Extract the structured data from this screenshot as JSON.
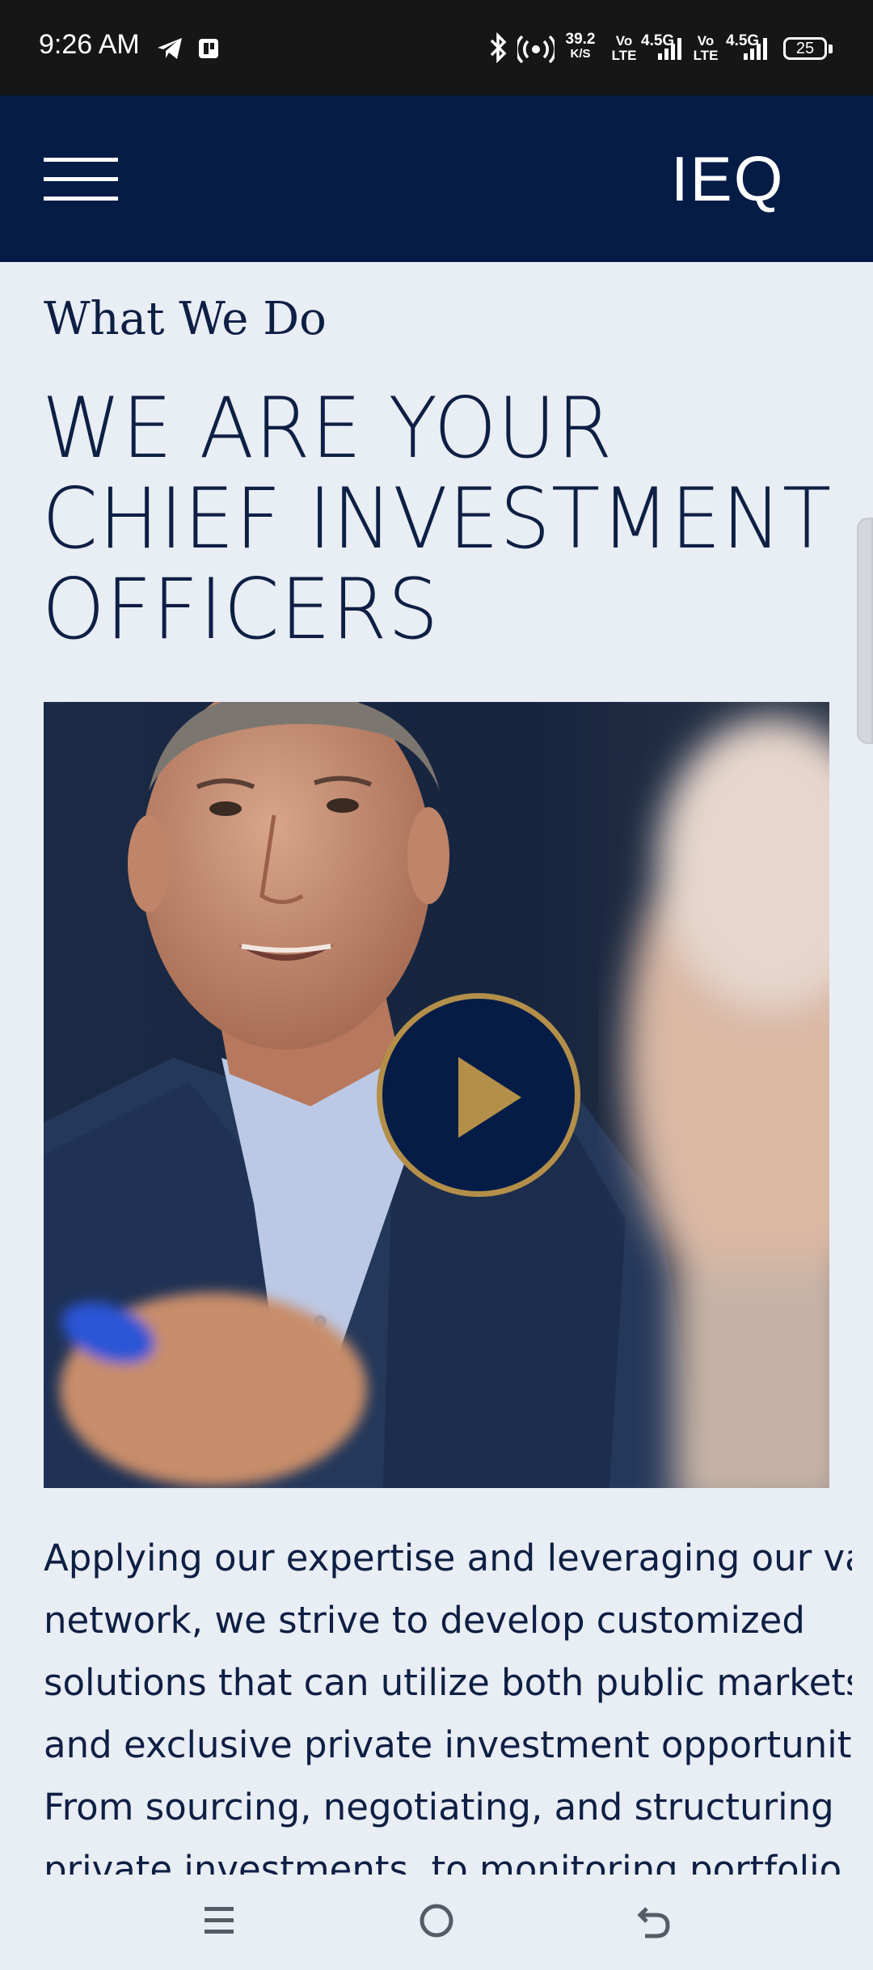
{
  "status_bar": {
    "time": "9:26 AM",
    "speed_value": "39.2",
    "speed_unit": "K/S",
    "sim1_label_top": "Vo",
    "sim1_label_bottom": "LTE",
    "sim1_network": "4.5G",
    "sim2_label_top": "Vo",
    "sim2_label_bottom": "LTE",
    "sim2_network": "4.5G",
    "battery": "25",
    "icons": [
      "telegram-icon",
      "app-notification-icon",
      "bluetooth-icon",
      "hotspot-icon",
      "signal-icon",
      "battery-icon"
    ]
  },
  "header": {
    "logo": "IEQ",
    "menu_icon": "hamburger-menu-icon"
  },
  "section": {
    "eyebrow": "What We Do",
    "headline_lines": [
      "WE ARE YOUR",
      "CHIEF INVESTMENT",
      "OFFICERS"
    ]
  },
  "video": {
    "play_icon": "play-icon",
    "accent_color": "#b38f4a"
  },
  "body": {
    "lines": [
      "Applying our expertise and leveraging our vast",
      "network, we strive to develop customized",
      "solutions that can utilize both public markets",
      "and exclusive private investment opportunities.",
      "From sourcing, negotiating, and structuring",
      "private investments, to monitoring portfolio"
    ]
  },
  "nav": {
    "icons": [
      "recents-icon",
      "home-icon",
      "back-icon"
    ]
  },
  "colors": {
    "header_bg": "#041c46",
    "page_bg": "#e9edf4",
    "text": "#0e1f44",
    "accent_gold": "#b38f4a"
  }
}
